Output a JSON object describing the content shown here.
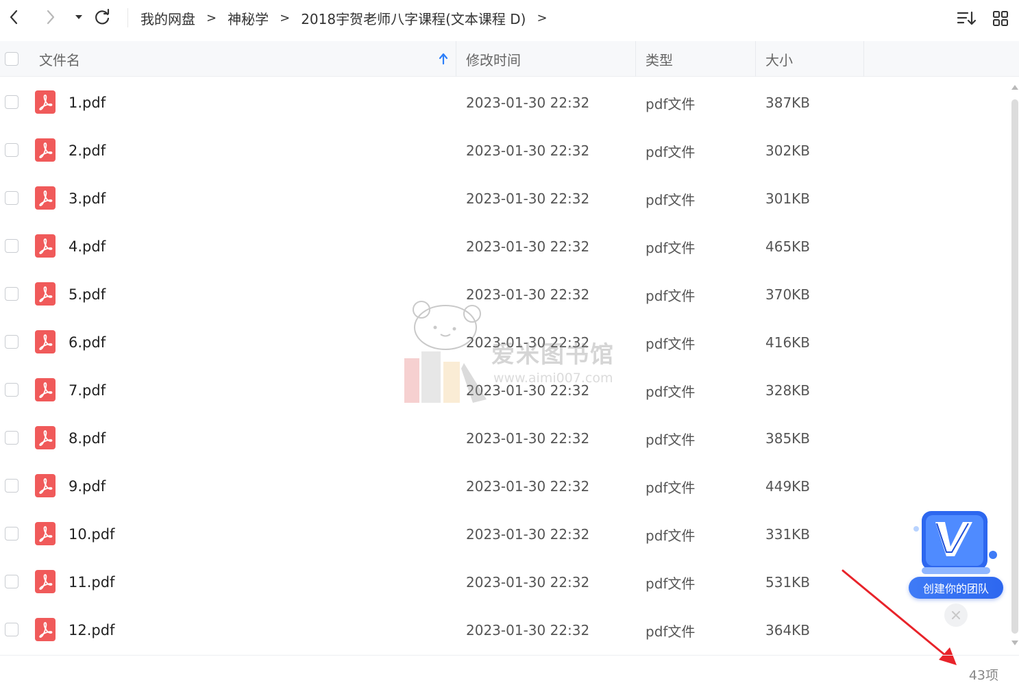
{
  "toolbar": {
    "back_icon": "chevron-left-icon",
    "forward_icon": "chevron-right-icon",
    "history_icon": "caret-down-icon",
    "refresh_icon": "refresh-icon",
    "breadcrumb": [
      "我的网盘",
      "神秘学",
      "2018宇贺老师八字课程(文本课程 D)"
    ],
    "crumb_sep": ">",
    "sort_icon": "sort-list-icon",
    "grid_icon": "grid-view-icon"
  },
  "header": {
    "name": "文件名",
    "modified": "修改时间",
    "type": "类型",
    "size": "大小",
    "sort_direction": "ascending"
  },
  "files": [
    {
      "name": "1.pdf",
      "modified": "2023-01-30 22:32",
      "type": "pdf文件",
      "size": "387KB"
    },
    {
      "name": "2.pdf",
      "modified": "2023-01-30 22:32",
      "type": "pdf文件",
      "size": "302KB"
    },
    {
      "name": "3.pdf",
      "modified": "2023-01-30 22:32",
      "type": "pdf文件",
      "size": "301KB"
    },
    {
      "name": "4.pdf",
      "modified": "2023-01-30 22:32",
      "type": "pdf文件",
      "size": "465KB"
    },
    {
      "name": "5.pdf",
      "modified": "2023-01-30 22:32",
      "type": "pdf文件",
      "size": "370KB"
    },
    {
      "name": "6.pdf",
      "modified": "2023-01-30 22:32",
      "type": "pdf文件",
      "size": "416KB"
    },
    {
      "name": "7.pdf",
      "modified": "2023-01-30 22:32",
      "type": "pdf文件",
      "size": "328KB"
    },
    {
      "name": "8.pdf",
      "modified": "2023-01-30 22:32",
      "type": "pdf文件",
      "size": "385KB"
    },
    {
      "name": "9.pdf",
      "modified": "2023-01-30 22:32",
      "type": "pdf文件",
      "size": "449KB"
    },
    {
      "name": "10.pdf",
      "modified": "2023-01-30 22:32",
      "type": "pdf文件",
      "size": "331KB"
    },
    {
      "name": "11.pdf",
      "modified": "2023-01-30 22:32",
      "type": "pdf文件",
      "size": "531KB"
    },
    {
      "name": "12.pdf",
      "modified": "2023-01-30 22:32",
      "type": "pdf文件",
      "size": "364KB"
    }
  ],
  "footer": {
    "item_count": "43项"
  },
  "watermark": {
    "title": "爱米图书馆",
    "url": "www.aimi007.com"
  },
  "team_widget": {
    "label": "创建你的团队",
    "badge": "V"
  },
  "colors": {
    "pdf_icon": "#f05a5a",
    "accent": "#2d7ff9",
    "header_bg": "#f7f8fa",
    "annotation_arrow": "#e8232a"
  }
}
